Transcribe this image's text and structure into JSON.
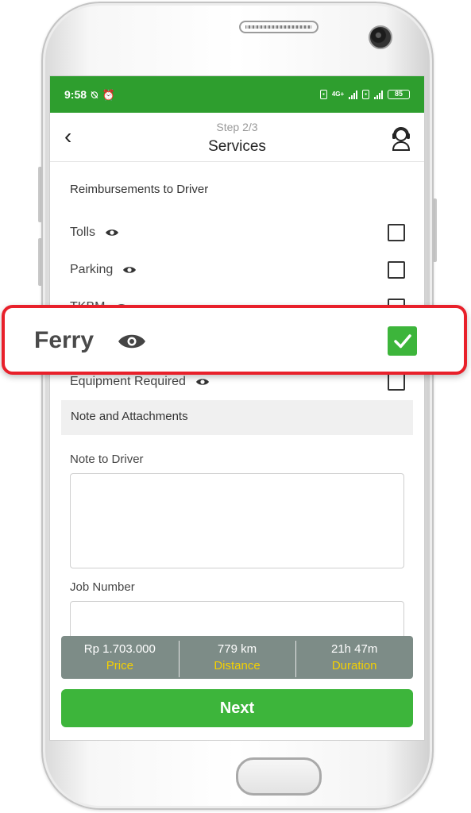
{
  "status_bar": {
    "time": "9:58",
    "network": "4G+",
    "battery": "85"
  },
  "header": {
    "step": "Step 2/3",
    "title": "Services"
  },
  "reimbursements": {
    "section_title": "Reimbursements to Driver",
    "items": [
      {
        "label": "Tolls",
        "checked": false
      },
      {
        "label": "Parking",
        "checked": false
      },
      {
        "label": "TKBM",
        "checked": false
      },
      {
        "label": "Equipment Required",
        "checked": false
      }
    ]
  },
  "highlight": {
    "label": "Ferry",
    "checked": true
  },
  "notes": {
    "section_title": "Note and Attachments",
    "note_label": "Note to Driver",
    "job_label": "Job Number"
  },
  "summary": {
    "price_value": "Rp 1.703.000",
    "price_label": "Price",
    "distance_value": "779 km",
    "distance_label": "Distance",
    "duration_value": "21h 47m",
    "duration_label": "Duration"
  },
  "next_label": "Next",
  "colors": {
    "brand_green": "#3db53b",
    "status_green": "#2e9e2e",
    "highlight_red": "#e8202a",
    "summary_bg": "#7d8c87",
    "summary_label": "#f4d000"
  }
}
